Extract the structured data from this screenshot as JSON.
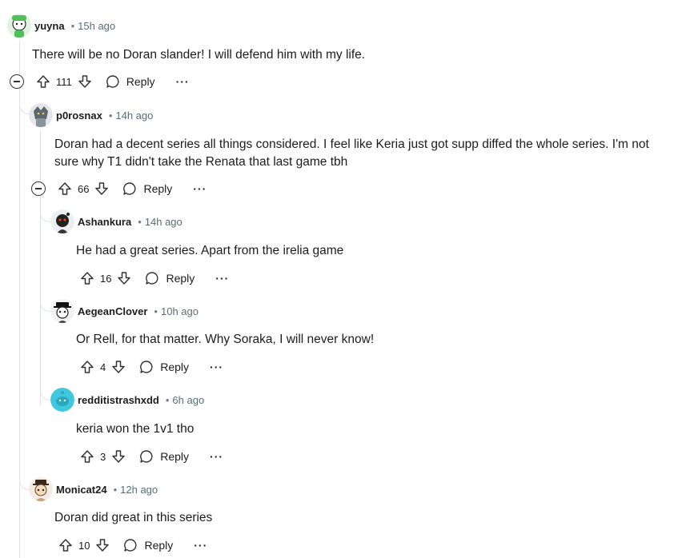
{
  "comments": [
    {
      "user": "yuyna",
      "time": "15h ago",
      "text": "There will be no Doran slander! I will defend him with my life.",
      "score": "111",
      "reply": "Reply",
      "more": "···",
      "avatar_color": "#4fbf5a"
    },
    {
      "user": "p0rosnax",
      "time": "14h ago",
      "text": "Doran had a decent series all things considered. I feel like Keria just got supp diffed the whole series. I'm not sure why T1 didn't take the Renata that last game tbh",
      "score": "66",
      "reply": "Reply",
      "more": "···",
      "avatar_color": "#5d6770"
    },
    {
      "user": "Ashankura",
      "time": "14h ago",
      "text": "He had a great series. Apart from the irelia game",
      "score": "16",
      "reply": "Reply",
      "more": "···",
      "avatar_color": "#222222"
    },
    {
      "user": "AegeanClover",
      "time": "10h ago",
      "text": "Or Rell, for that matter. Why Soraka, I will never know!",
      "score": "4",
      "reply": "Reply",
      "more": "···",
      "avatar_color": "#e9e9e9"
    },
    {
      "user": "redditistrashxdd",
      "time": "6h ago",
      "text": "keria won the 1v1 tho",
      "score": "3",
      "reply": "Reply",
      "more": "···",
      "avatar_color": "#3fc8dd"
    },
    {
      "user": "Monicat24",
      "time": "12h ago",
      "text": "Doran did great in this series",
      "score": "10",
      "reply": "Reply",
      "more": "···",
      "avatar_color": "#c9a27a"
    }
  ],
  "separator": "•"
}
